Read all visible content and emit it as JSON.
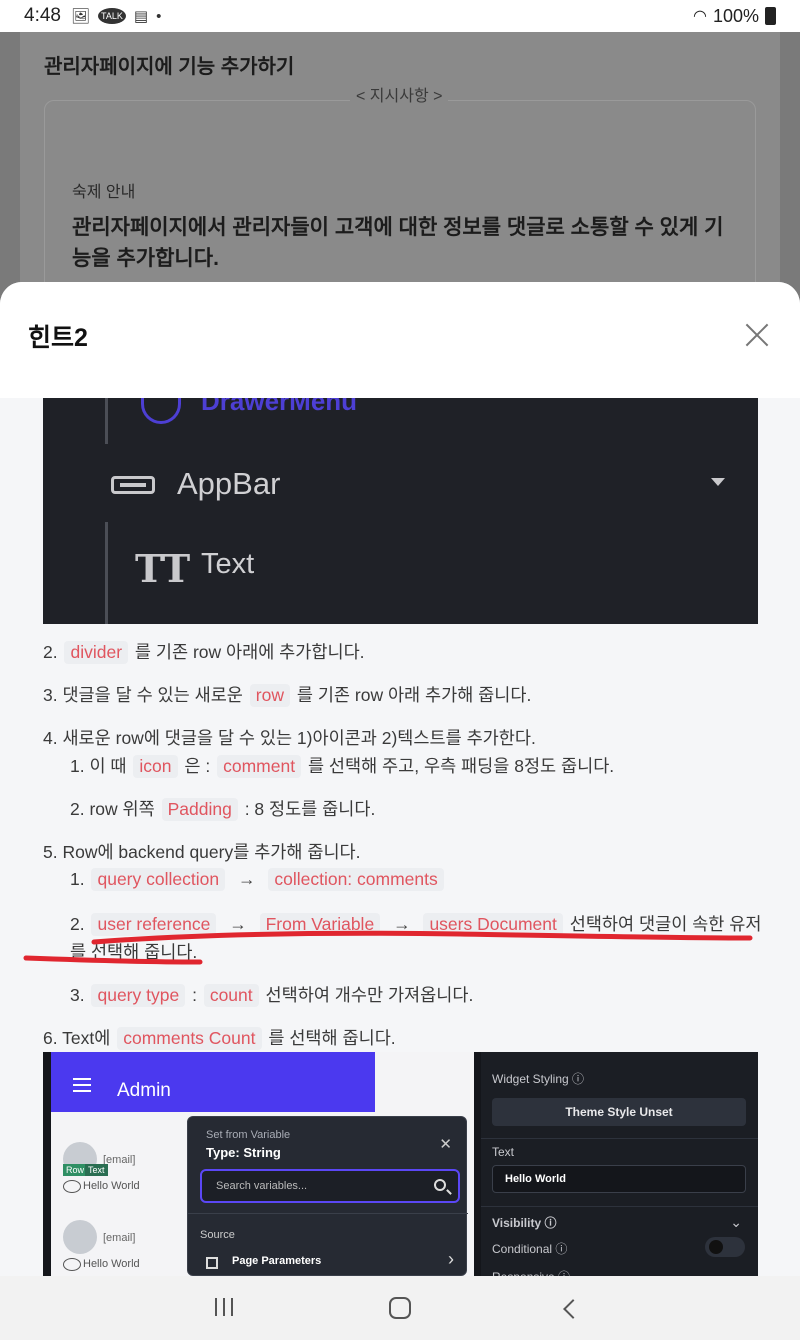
{
  "status_bar": {
    "time": "4:48",
    "battery": "100%",
    "notification_icons": [
      "image-icon",
      "kakaotalk-icon",
      "calendar-icon"
    ],
    "talk_label": "TALK"
  },
  "background_page": {
    "title": "관리자페이지에 기능 추가하기",
    "legend": "< 지시사항 >",
    "homework_label": "숙제 안내",
    "homework_text": "관리자페이지에서 관리자들이 고객에 대한 정보를 댓글로 소통할 수 있게 기능을 추가합니다."
  },
  "sheet": {
    "title": "힌트2"
  },
  "screenshot1": {
    "drawer_label": "DrawerMenu",
    "appbar_label": "AppBar",
    "text_icon": "TT",
    "text_label": "Text"
  },
  "steps": {
    "s2": {
      "num": "2.",
      "code": "divider",
      "text": "를 기존 row 아래에 추가합니다."
    },
    "s3": {
      "text1": "3. 댓글을 달 수 있는 새로운",
      "code": "row",
      "text2": "를 기존 row 아래 추가해 줍니다."
    },
    "s4": {
      "text": "4. 새로운 row에 댓글을 달 수 있는 1)아이콘과 2)텍스트를 추가한다.",
      "sub1": {
        "num": "1. 이 때",
        "code1": "icon",
        "mid": "은 :",
        "code2": "comment",
        "text": "를 선택해 주고, 우측 패딩을 8정도 줍니다."
      },
      "sub2": {
        "num": "2. row 위쪽",
        "code": "Padding",
        "text": ": 8 정도를 줍니다."
      }
    },
    "s5": {
      "text": "5. Row에 backend query를 추가해 줍니다.",
      "sub1": {
        "num": "1.",
        "code1": "query collection",
        "arrow": "→",
        "code2": "collection: comments"
      },
      "sub2": {
        "num": "2.",
        "code1": "user reference",
        "arrow": "→",
        "code2": "From Variable",
        "code3": "users Document",
        "text": "선택하여 댓글이 속한 유저",
        "text_cont": "를 선택해 줍니다."
      },
      "sub3": {
        "num": "3.",
        "code1": "query type",
        "colon": ":",
        "code2": "count",
        "text": "선택하여 개수만 가져옵니다."
      }
    },
    "s6": {
      "text1": "6. Text에",
      "code": "comments Count",
      "text2": "를 선택해 줍니다."
    }
  },
  "screenshot2": {
    "app_title": "Admin",
    "rows": [
      {
        "email": "[email]",
        "text": "Hello World",
        "tag1": "Row",
        "tag2": "Text"
      },
      {
        "email": "[email]",
        "text": "Hello World"
      }
    ],
    "popup": {
      "subtitle": "Set from Variable",
      "title": "Type: String",
      "close": "✕",
      "search_placeholder": "Search variables...",
      "source_label": "Source",
      "page_parameters": "Page Parameters",
      "chevron": "›"
    },
    "panel": {
      "widget_styling": "Widget Styling ⓘ",
      "theme_button": "Theme Style Unset",
      "text_label": "Text",
      "text_value": "Hello World",
      "visibility": "Visibility ⓘ",
      "conditional": "Conditional ⓘ",
      "responsive": "Responsive ⓘ"
    }
  },
  "colors": {
    "code_text": "#e0555f",
    "code_bg": "#eceef1",
    "annotation": "#e0262f",
    "accent": "#4b39ef"
  }
}
